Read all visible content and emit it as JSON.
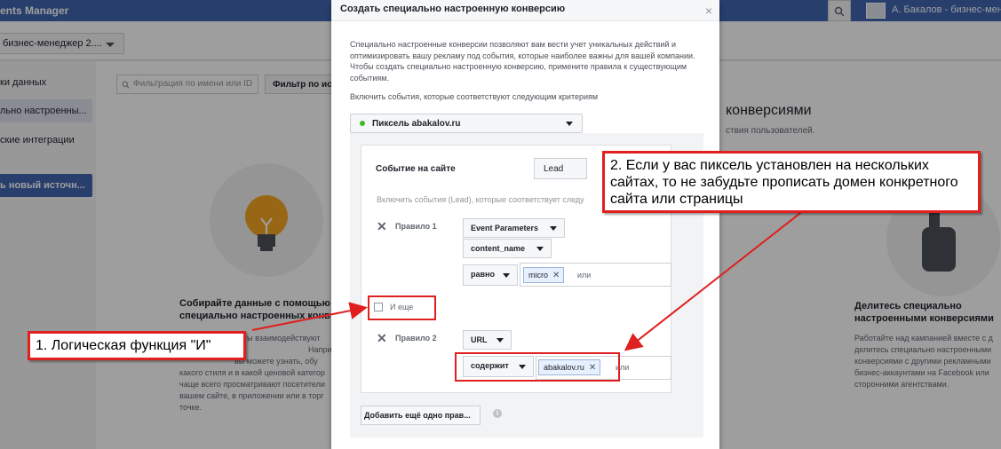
{
  "app": {
    "title": "ents Manager",
    "account_name": "А. Бакалов - бизнес-менед...",
    "business_selector": "бизнес-менеджер 2...."
  },
  "sidebar": {
    "items": [
      {
        "label": "ки данных"
      },
      {
        "label": "льно настроенны..."
      },
      {
        "label": "ские интеграции"
      }
    ],
    "button": "ь новый источн..."
  },
  "main": {
    "filter_placeholder": "Фильтрация по имени или ID",
    "filter_button": "Фильтр по ист",
    "heading_fragment": "конверсиями",
    "subheading_fragment": "ствия пользователей.",
    "left_card": {
      "title_lines": [
        "Собирайте данные с помощью",
        "специально настроенных конв"
      ],
      "text_lines": [
        "енты взаимодействуют",
        "Например, вы",
        "вы можете узнать, обу",
        "какого стиля и в какой ценовой категор",
        "чаще всего просматривают посетители",
        "вашем сайте, в приложении или в торг",
        "точке."
      ]
    },
    "right_card": {
      "title_lines": [
        "Делитесь специально",
        "настроенными конверсиями"
      ],
      "text_lines": [
        "Работайте над кампанией вместе с д",
        "делитесь специально настроенными",
        "конверсиями с другими рекламными",
        "бизнес-аккаунтами на Facebook или",
        "сторонними агентствами."
      ]
    }
  },
  "modal": {
    "title": "Создать специально настроенную конверсию",
    "close": "×",
    "description": "Специально настроенные конверсии позволяют вам вести учет уникальных действий и оптимизировать вашу рекламу под события, которые наиболее важны для вашей компании. Чтобы создать специально настроенную конверсию, примените правила к существующим событиям.",
    "criteria_label": "Включить события, которые соответствуют следующим критериям",
    "pixel": "Пиксель abakalov.ru",
    "event_label": "Событие на сайте",
    "event_value": "Lead",
    "include_hint": "Включить события (Lead), которые соответствует следу",
    "rule1": {
      "label": "Правило 1",
      "param": "Event Parameters",
      "field": "content_name",
      "operator": "равно",
      "token": "micro",
      "or": "или"
    },
    "and_label": "И еще",
    "rule2": {
      "label": "Правило 2",
      "param": "URL",
      "operator": "содержит",
      "token": "abakalov.ru",
      "or": "или"
    },
    "add_rule": "Добавить ещё одно прав...",
    "info": "i"
  },
  "annotations": {
    "callout1": "1. Логическая функция \"И\"",
    "callout2": "2. Если у вас пиксель установлен на нескольких сайтах, то не забудьте прописать домен конкретного сайта или страницы"
  }
}
